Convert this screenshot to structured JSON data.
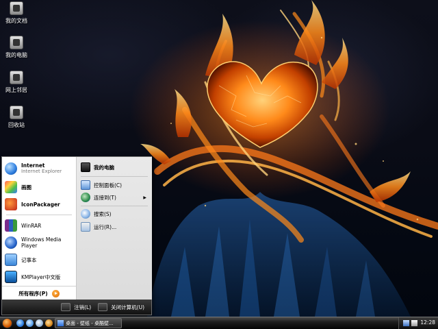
{
  "desktop": {
    "icons": [
      {
        "label": "我的文档",
        "icon": "my-documents-icon"
      },
      {
        "label": "我的电脑",
        "icon": "my-computer-icon"
      },
      {
        "label": "网上邻居",
        "icon": "network-places-icon"
      },
      {
        "label": "回收站",
        "icon": "recycle-bin-icon"
      }
    ]
  },
  "start_menu": {
    "pinned": [
      {
        "title": "Internet",
        "subtitle": "Internet Explorer",
        "icon": "internet-explorer-icon"
      },
      {
        "title": "画图",
        "icon": "paint-icon"
      },
      {
        "title": "IconPackager",
        "icon": "iconpackager-icon"
      }
    ],
    "recent": [
      {
        "title": "WinRAR",
        "icon": "winrar-icon"
      },
      {
        "title": "Windows Media Player",
        "icon": "media-player-icon"
      },
      {
        "title": "记事本",
        "icon": "notepad-icon"
      },
      {
        "title": "KMPlayer中文版",
        "icon": "kmplayer-icon"
      }
    ],
    "all_programs": "所有程序(P)",
    "right": [
      {
        "title": "我的电脑",
        "icon": "my-computer-icon",
        "bold": true
      },
      {
        "title": "控制面板(C)",
        "icon": "control-panel-icon"
      },
      {
        "title": "连接到(T)",
        "icon": "connect-to-icon",
        "submenu": true
      },
      {
        "title": "搜索(S)",
        "icon": "search-icon"
      },
      {
        "title": "运行(R)...",
        "icon": "run-icon"
      }
    ],
    "footer": {
      "logoff": "注销(L)",
      "shutdown": "关闭计算机(U)"
    }
  },
  "taskbar": {
    "task": "桌面 - 壁纸 - 桌酷壁...",
    "clock": "12:28"
  },
  "colors": {
    "flame": "#ff7a1a",
    "taskbar": "#1d1d1d",
    "accent": "#d45a00"
  }
}
